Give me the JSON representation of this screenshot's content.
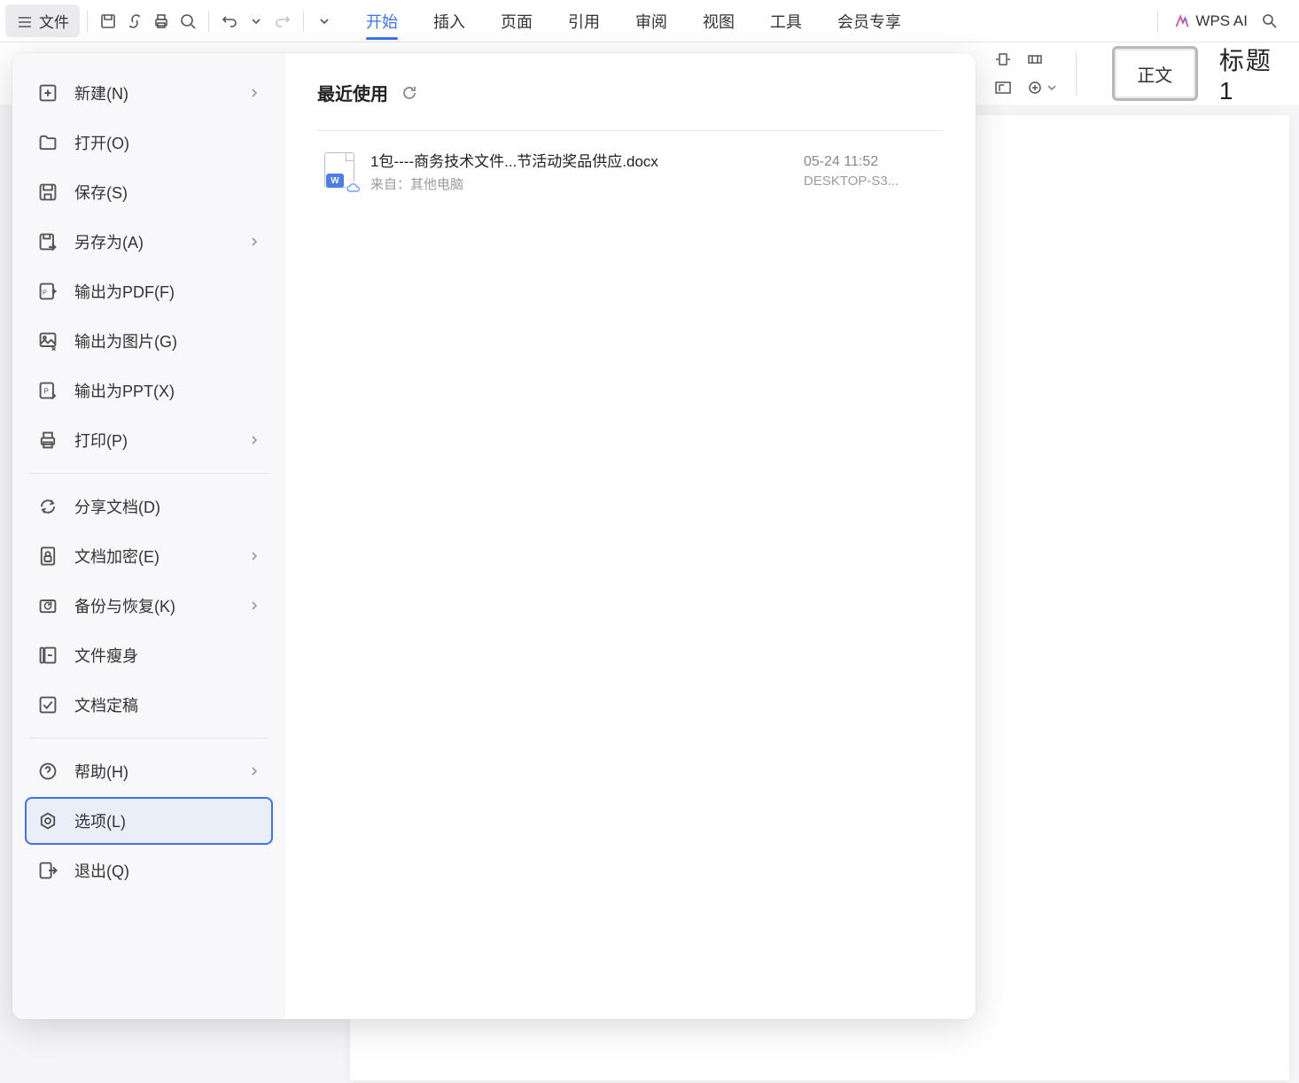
{
  "toolbar": {
    "file_label": "文件",
    "tabs": [
      "开始",
      "插入",
      "页面",
      "引用",
      "审阅",
      "视图",
      "工具",
      "会员专享"
    ],
    "active_tab_index": 0,
    "wps_ai": "WPS AI"
  },
  "styles": {
    "normal": "正文",
    "heading1": "标题  1"
  },
  "file_menu": {
    "items": [
      {
        "key": "new",
        "label": "新建(N)",
        "arrow": true
      },
      {
        "key": "open",
        "label": "打开(O)",
        "arrow": false
      },
      {
        "key": "save",
        "label": "保存(S)",
        "arrow": false
      },
      {
        "key": "saveas",
        "label": "另存为(A)",
        "arrow": true
      },
      {
        "key": "exportpdf",
        "label": "输出为PDF(F)",
        "arrow": false
      },
      {
        "key": "exportimg",
        "label": "输出为图片(G)",
        "arrow": false
      },
      {
        "key": "exportppt",
        "label": "输出为PPT(X)",
        "arrow": false
      },
      {
        "key": "print",
        "label": "打印(P)",
        "arrow": true
      },
      {
        "key": "share",
        "label": "分享文档(D)",
        "arrow": false
      },
      {
        "key": "encrypt",
        "label": "文档加密(E)",
        "arrow": true
      },
      {
        "key": "backup",
        "label": "备份与恢复(K)",
        "arrow": true
      },
      {
        "key": "slim",
        "label": "文件瘦身",
        "arrow": false
      },
      {
        "key": "finalize",
        "label": "文档定稿",
        "arrow": false
      },
      {
        "key": "help",
        "label": "帮助(H)",
        "arrow": true
      },
      {
        "key": "options",
        "label": "选项(L)",
        "arrow": false
      },
      {
        "key": "exit",
        "label": "退出(Q)",
        "arrow": false
      }
    ],
    "dividers_after": [
      "print",
      "finalize"
    ],
    "selected": "options"
  },
  "recent": {
    "title": "最近使用",
    "files": [
      {
        "name": "1包----商务技术文件...节活动奖品供应.docx",
        "source_label": "来自：其他电脑",
        "timestamp": "05-24 11:52",
        "location": "DESKTOP-S3..."
      }
    ]
  }
}
